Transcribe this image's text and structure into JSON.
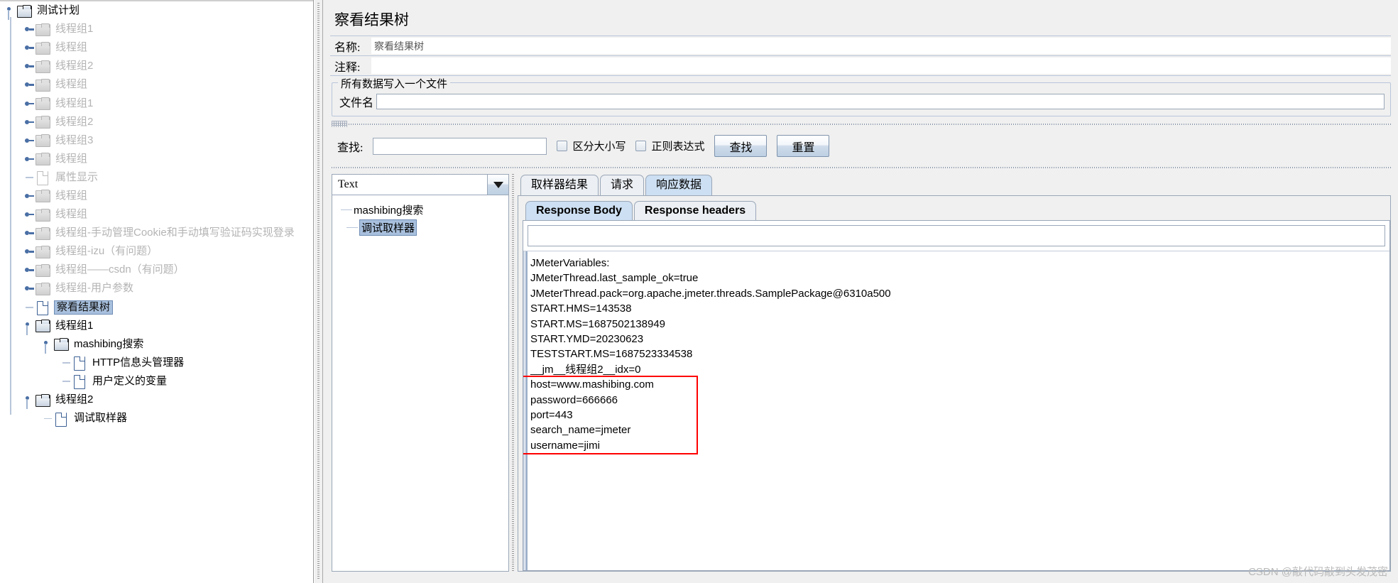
{
  "tree": {
    "root": {
      "label": "测试计划",
      "icon": "folder-icon",
      "state": "expanded"
    },
    "items": [
      {
        "label": "线程组1",
        "icon": "folder-icon",
        "state": "collapsed",
        "dim": true,
        "depth": 1
      },
      {
        "label": "线程组",
        "icon": "folder-icon",
        "state": "collapsed",
        "dim": true,
        "depth": 1
      },
      {
        "label": "线程组2",
        "icon": "folder-icon",
        "state": "collapsed",
        "dim": true,
        "depth": 1
      },
      {
        "label": "线程组",
        "icon": "folder-icon",
        "state": "collapsed",
        "dim": true,
        "depth": 1
      },
      {
        "label": "线程组1",
        "icon": "folder-icon",
        "state": "collapsed",
        "dim": true,
        "depth": 1
      },
      {
        "label": "线程组2",
        "icon": "folder-icon",
        "state": "collapsed",
        "dim": true,
        "depth": 1
      },
      {
        "label": "线程组3",
        "icon": "folder-icon",
        "state": "collapsed",
        "dim": true,
        "depth": 1
      },
      {
        "label": "线程组",
        "icon": "folder-icon",
        "state": "collapsed",
        "dim": true,
        "depth": 1
      },
      {
        "label": "属性显示",
        "icon": "document-icon",
        "state": "leaf",
        "dim": true,
        "depth": 1
      },
      {
        "label": "线程组",
        "icon": "folder-icon",
        "state": "collapsed",
        "dim": true,
        "depth": 1
      },
      {
        "label": "线程组",
        "icon": "folder-icon",
        "state": "collapsed",
        "dim": true,
        "depth": 1
      },
      {
        "label": "线程组-手动管理Cookie和手动填写验证码实现登录",
        "icon": "folder-icon",
        "state": "collapsed",
        "dim": true,
        "depth": 1
      },
      {
        "label": "线程组-izu（有问题）",
        "icon": "folder-icon",
        "state": "collapsed",
        "dim": true,
        "depth": 1
      },
      {
        "label": "线程组——csdn（有问题）",
        "icon": "folder-icon",
        "state": "collapsed",
        "dim": true,
        "depth": 1
      },
      {
        "label": "线程组-用户参数",
        "icon": "folder-icon",
        "state": "collapsed",
        "dim": true,
        "depth": 1
      },
      {
        "label": "察看结果树",
        "icon": "document-icon",
        "state": "leaf",
        "dim": false,
        "selected": true,
        "depth": 1
      },
      {
        "label": "线程组1",
        "icon": "folder-icon",
        "state": "expanded",
        "dim": false,
        "depth": 1
      },
      {
        "label": "mashibing搜索",
        "icon": "folder-icon",
        "state": "expanded",
        "dim": false,
        "depth": 2
      },
      {
        "label": "HTTP信息头管理器",
        "icon": "document-icon",
        "state": "leaf",
        "dim": false,
        "depth": 3
      },
      {
        "label": "用户定义的变量",
        "icon": "document-icon",
        "state": "leaf",
        "dim": false,
        "depth": 3
      },
      {
        "label": "线程组2",
        "icon": "folder-icon",
        "state": "expanded",
        "dim": false,
        "depth": 1
      },
      {
        "label": "调试取样器",
        "icon": "document-icon",
        "state": "leaf",
        "dim": false,
        "depth": 2
      }
    ]
  },
  "panel": {
    "title": "察看结果树",
    "name_label": "名称:",
    "name_value": "察看结果树",
    "comment_label": "注释:",
    "comment_value": "",
    "file_group_title": "所有数据写入一个文件",
    "file_label": "文件名",
    "file_value": ""
  },
  "search": {
    "label": "查找:",
    "value": "",
    "case_sensitive_label": "区分大小写",
    "case_sensitive_checked": false,
    "regex_label": "正则表达式",
    "regex_checked": false,
    "find_button": "查找",
    "reset_button": "重置"
  },
  "renderer": {
    "selected": "Text",
    "icon": "chevron-down-icon"
  },
  "results_tree": {
    "items": [
      {
        "label": "mashibing搜索",
        "selected": false
      },
      {
        "label": "调试取样器",
        "selected": true
      }
    ]
  },
  "tabs": {
    "main": [
      {
        "label": "取样器结果",
        "active": false
      },
      {
        "label": "请求",
        "active": false
      },
      {
        "label": "响应数据",
        "active": true
      }
    ],
    "sub": [
      {
        "label": "Response Body",
        "active": true
      },
      {
        "label": "Response headers",
        "active": false
      }
    ]
  },
  "response_body": {
    "filter_value": "",
    "lines": [
      "JMeterVariables:",
      "JMeterThread.last_sample_ok=true",
      "JMeterThread.pack=org.apache.jmeter.threads.SamplePackage@6310a500",
      "START.HMS=143538",
      "START.MS=1687502138949",
      "START.YMD=20230623",
      "TESTSTART.MS=1687523334538",
      "__jm__线程组2__idx=0",
      "host=www.mashibing.com",
      "password=666666",
      "port=443",
      "search_name=jmeter",
      "username=jimi"
    ],
    "highlight_start_index": 8,
    "highlight_end_index": 12,
    "highlight_color": "#ff0000"
  },
  "watermark": "CSDN @敲代码敲到头发茂密"
}
